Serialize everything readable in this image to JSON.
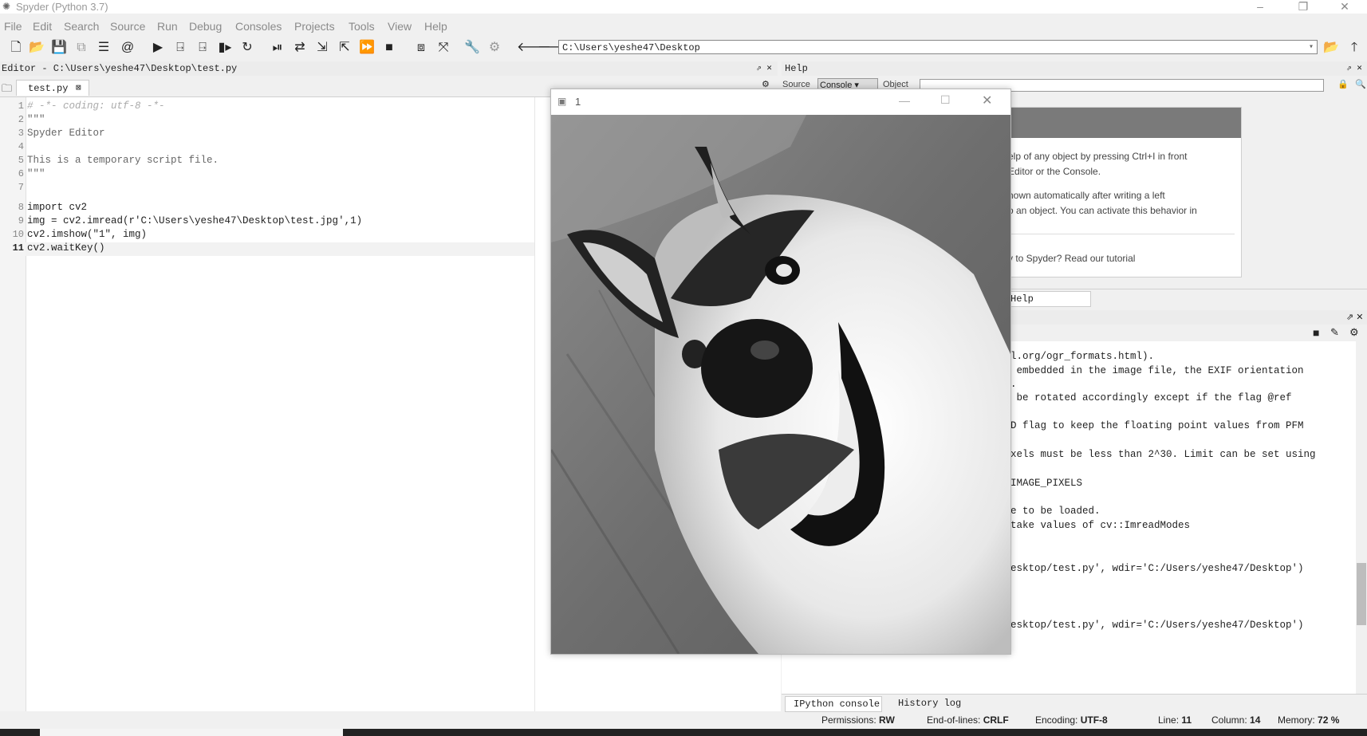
{
  "window": {
    "title": "Spyder (Python 3.7)"
  },
  "menu": [
    "File",
    "Edit",
    "Search",
    "Source",
    "Run",
    "Debug",
    "Consoles",
    "Projects",
    "Tools",
    "View",
    "Help"
  ],
  "toolbar": {
    "path": "C:\\Users\\yeshe47\\Desktop"
  },
  "editor": {
    "header": "Editor - C:\\Users\\yeshe47\\Desktop\\test.py",
    "tab": "test.py",
    "lines": [
      {
        "n": "1",
        "text": "# -*- coding: utf-8 -*-"
      },
      {
        "n": "2",
        "text": "\"\"\""
      },
      {
        "n": "3",
        "text": "Spyder Editor"
      },
      {
        "n": "4",
        "text": ""
      },
      {
        "n": "5",
        "text": "This is a temporary script file."
      },
      {
        "n": "6",
        "text": "\"\"\""
      },
      {
        "n": "7",
        "text": ""
      },
      {
        "n": "8",
        "text": "import cv2"
      },
      {
        "n": "9",
        "text": "img = cv2.imread(r'C:\\Users\\yeshe47\\Desktop\\test.jpg',1)"
      },
      {
        "n": "10",
        "text": "cv2.imshow(\"1\", img)"
      },
      {
        "n": "11",
        "text": "cv2.waitKey()"
      }
    ]
  },
  "help": {
    "header": "Help",
    "source_label": "Source",
    "source_value": "Console",
    "object_label": "Object",
    "lines": [
      "elp of any object by pressing Ctrl+I in front",
      "Editor or the Console.",
      "hown automatically after writing a left",
      "o an object. You can activate this behavior in",
      ".",
      "v to Spyder? Read our tutorial"
    ],
    "bottom_tab": "Help"
  },
  "console": {
    "lines": [
      "l.org/ogr_formats.html).",
      " embedded in the image file, the EXIF orientation",
      ".",
      " be rotated accordingly except if the flag @ref",
      "",
      "D flag to keep the floating point values from PFM",
      "",
      "xels must be less than 2^30. Limit can be set using",
      "",
      "IMAGE_PIXELS",
      "",
      "e to be loaded.",
      "take values of cv::ImreadModes",
      "",
      "",
      "esktop/test.py', wdir='C:/Users/yeshe47/Desktop')",
      "",
      "",
      "",
      "esktop/test.py', wdir='C:/Users/yeshe47/Desktop')"
    ],
    "tabs": [
      "IPython console",
      "History log"
    ]
  },
  "status": {
    "permissions_label": "Permissions:",
    "permissions": "RW",
    "eol_label": "End-of-lines:",
    "eol": "CRLF",
    "encoding_label": "Encoding:",
    "encoding": "UTF-8",
    "line_label": "Line:",
    "line": "11",
    "column_label": "Column:",
    "column": "14",
    "memory_label": "Memory:",
    "memory": "72 %"
  },
  "image_window": {
    "title": "1"
  }
}
